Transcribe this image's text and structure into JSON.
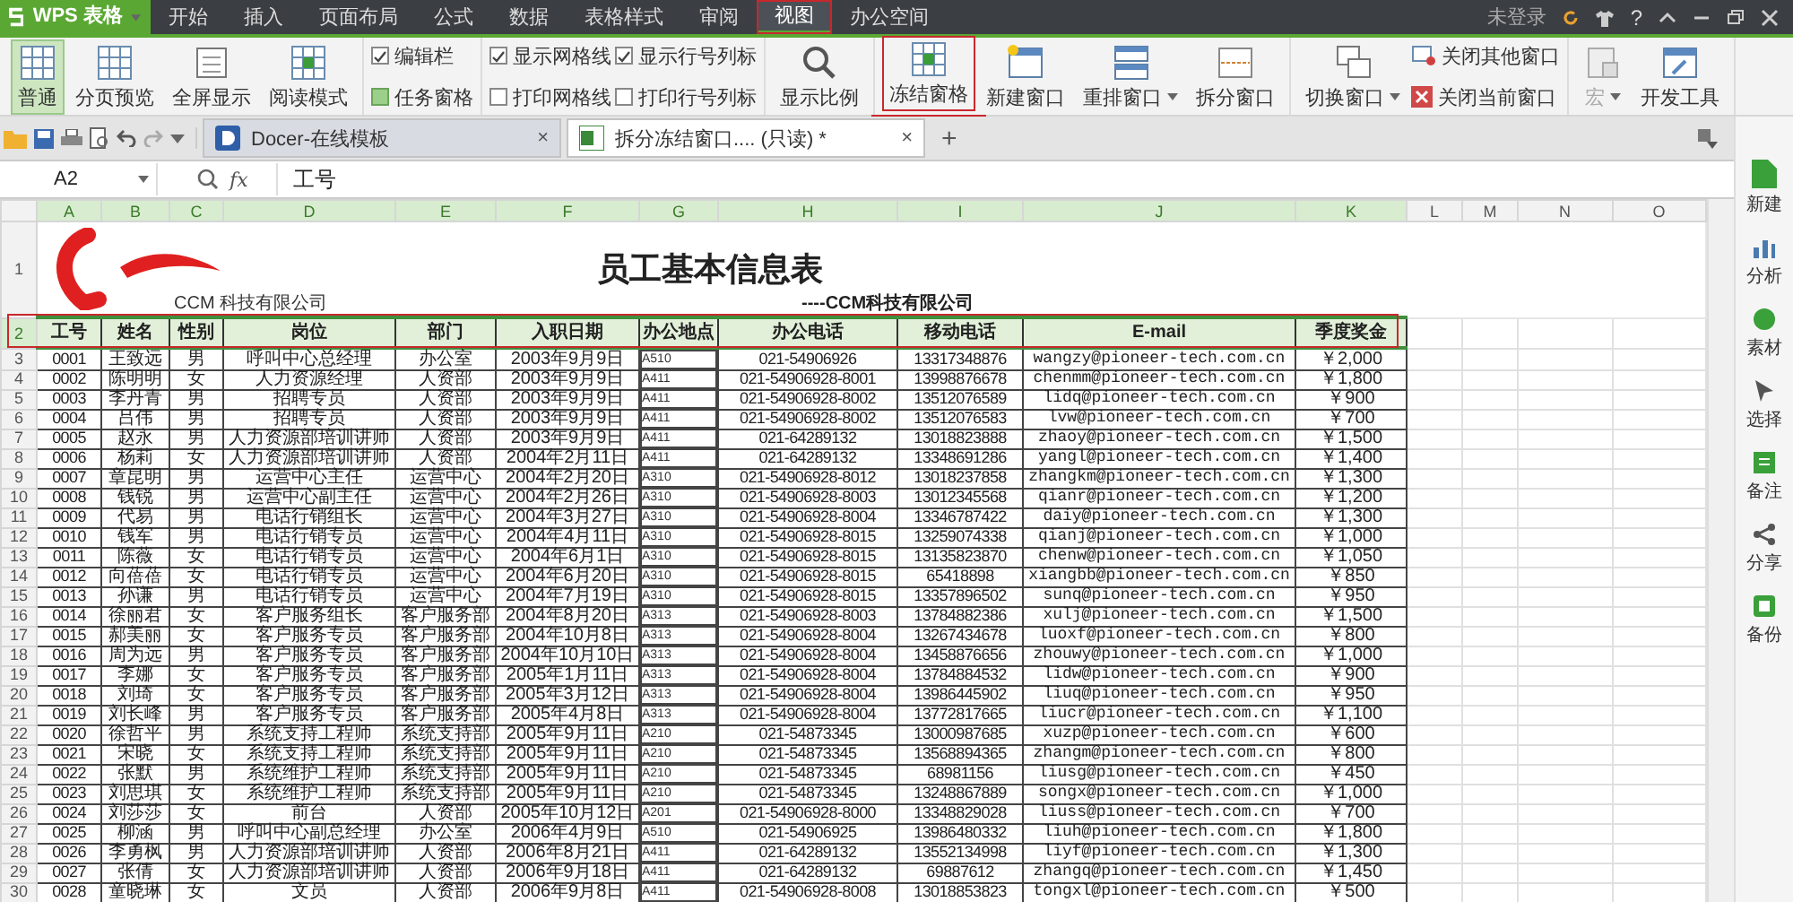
{
  "app": {
    "name": "WPS 表格"
  },
  "menu_tabs": [
    {
      "label": "开始",
      "selected": false,
      "annotated": false
    },
    {
      "label": "插入",
      "selected": false,
      "annotated": false
    },
    {
      "label": "页面布局",
      "selected": false,
      "annotated": false
    },
    {
      "label": "公式",
      "selected": false,
      "annotated": false
    },
    {
      "label": "数据",
      "selected": false,
      "annotated": false
    },
    {
      "label": "表格样式",
      "selected": false,
      "annotated": false
    },
    {
      "label": "审阅",
      "selected": false,
      "annotated": false
    },
    {
      "label": "视图",
      "selected": true,
      "annotated": true
    },
    {
      "label": "办公空间",
      "selected": false,
      "annotated": false
    }
  ],
  "account": {
    "status": "未登录",
    "help": "?"
  },
  "ribbon": {
    "groups": [
      {
        "items": [
          {
            "kind": "large",
            "label": "普通",
            "selected": true
          },
          {
            "kind": "large",
            "label": "分页预览",
            "selected": false
          },
          {
            "kind": "large",
            "label": "全屏显示",
            "selected": false
          },
          {
            "kind": "large",
            "label": "阅读模式",
            "selected": false
          }
        ]
      },
      {
        "items": [
          {
            "kind": "check",
            "label": "编辑栏",
            "checked": true
          },
          {
            "kind": "toggle",
            "label": "任务窗格",
            "checked": true
          }
        ]
      },
      {
        "items": [
          {
            "kind": "check",
            "label": "显示网格线",
            "checked": true
          },
          {
            "kind": "check",
            "label": "打印网格线",
            "checked": false
          },
          {
            "kind": "check",
            "label": "显示行号列标",
            "checked": true
          },
          {
            "kind": "check",
            "label": "打印行号列标",
            "checked": false
          }
        ]
      },
      {
        "items": [
          {
            "kind": "large",
            "label": "显示比例",
            "selected": false
          }
        ]
      },
      {
        "items": [
          {
            "kind": "large",
            "label": "冻结窗格",
            "selected": false,
            "annotated": true
          },
          {
            "kind": "large",
            "label": "新建窗口",
            "selected": false
          },
          {
            "kind": "large",
            "label": "重排窗口",
            "selected": false,
            "dropdown": true
          },
          {
            "kind": "large",
            "label": "拆分窗口",
            "selected": false
          }
        ]
      },
      {
        "items": [
          {
            "kind": "large",
            "label": "切换窗口",
            "selected": false,
            "dropdown": true
          },
          {
            "kind": "small",
            "label": "关闭其他窗口"
          },
          {
            "kind": "small",
            "label": "关闭当前窗口"
          }
        ]
      },
      {
        "items": [
          {
            "kind": "large",
            "label": "宏",
            "selected": false,
            "dropdown": true,
            "disabled": true
          },
          {
            "kind": "large",
            "label": "开发工具",
            "selected": false
          }
        ]
      }
    ]
  },
  "doc_tabs": [
    {
      "label": "Docer-在线模板",
      "selected": false,
      "close": "×"
    },
    {
      "label": "拆分冻结窗口.... (只读) *",
      "selected": true,
      "close": "×"
    }
  ],
  "new_tab": "+",
  "formula_bar": {
    "cell": "A2",
    "fx_label": "fx",
    "value": "工号"
  },
  "sheet": {
    "columns": [
      {
        "label": "A",
        "selected": true
      },
      {
        "label": "B",
        "selected": true
      },
      {
        "label": "C",
        "selected": true
      },
      {
        "label": "D",
        "selected": true
      },
      {
        "label": "E",
        "selected": true
      },
      {
        "label": "F",
        "selected": true
      },
      {
        "label": "G",
        "selected": true
      },
      {
        "label": "H",
        "selected": true
      },
      {
        "label": "I",
        "selected": true
      },
      {
        "label": "J",
        "selected": true
      },
      {
        "label": "K",
        "selected": true
      },
      {
        "label": "L",
        "selected": false
      },
      {
        "label": "M",
        "selected": false
      },
      {
        "label": "N",
        "selected": false
      },
      {
        "label": "O",
        "selected": false
      }
    ],
    "title_row": {
      "number": "1",
      "logo_text": "CCM 科技有限公司",
      "title": "员工基本信息表",
      "subtitle": "----CCM科技有限公司"
    },
    "header": {
      "number": "2",
      "selected": true,
      "annotated": true,
      "cells": [
        "工号",
        "姓名",
        "性别",
        "岗位",
        "部门",
        "入职日期",
        "办公地点",
        "办公电话",
        "移动电话",
        "E-mail",
        "季度奖金"
      ]
    },
    "rows": [
      {
        "number": "3",
        "selected": false,
        "cells": [
          "0001",
          "王致远",
          "男",
          "呼叫中心总经理",
          "办公室",
          "2003年9月9日",
          "A510",
          "021-54906926",
          "13317348876",
          "wangzy@pioneer-tech.com.cn",
          "￥2,000"
        ]
      },
      {
        "number": "4",
        "selected": false,
        "cells": [
          "0002",
          "陈明明",
          "女",
          "人力资源经理",
          "人资部",
          "2003年9月9日",
          "A411",
          "021-54906928-8001",
          "13998876678",
          "chenmm@pioneer-tech.com.cn",
          "￥1,800"
        ]
      },
      {
        "number": "5",
        "selected": false,
        "cells": [
          "0003",
          "李丹青",
          "男",
          "招聘专员",
          "人资部",
          "2003年9月9日",
          "A411",
          "021-54906928-8002",
          "13512076589",
          "lidq@pioneer-tech.com.cn",
          "￥900"
        ]
      },
      {
        "number": "6",
        "selected": false,
        "cells": [
          "0004",
          "吕伟",
          "男",
          "招聘专员",
          "人资部",
          "2003年9月9日",
          "A411",
          "021-54906928-8002",
          "13512076583",
          "lvw@pioneer-tech.com.cn",
          "￥700"
        ]
      },
      {
        "number": "7",
        "selected": false,
        "cells": [
          "0005",
          "赵永",
          "男",
          "人力资源部培训讲师",
          "人资部",
          "2003年9月9日",
          "A411",
          "021-64289132",
          "13018823888",
          "zhaoy@pioneer-tech.com.cn",
          "￥1,500"
        ]
      },
      {
        "number": "8",
        "selected": false,
        "cells": [
          "0006",
          "杨莉",
          "女",
          "人力资源部培训讲师",
          "人资部",
          "2004年2月11日",
          "A411",
          "021-64289132",
          "13348691286",
          "yangl@pioneer-tech.com.cn",
          "￥1,400"
        ]
      },
      {
        "number": "9",
        "selected": false,
        "cells": [
          "0007",
          "章昆明",
          "男",
          "运营中心主任",
          "运营中心",
          "2004年2月20日",
          "A310",
          "021-54906928-8012",
          "13018237858",
          "zhangkm@pioneer-tech.com.cn",
          "￥1,300"
        ]
      },
      {
        "number": "10",
        "selected": false,
        "cells": [
          "0008",
          "钱锐",
          "男",
          "运营中心副主任",
          "运营中心",
          "2004年2月26日",
          "A310",
          "021-54906928-8003",
          "13012345568",
          "qianr@pioneer-tech.com.cn",
          "￥1,200"
        ]
      },
      {
        "number": "11",
        "selected": false,
        "cells": [
          "0009",
          "代易",
          "男",
          "电话行销组长",
          "运营中心",
          "2004年3月27日",
          "A310",
          "021-54906928-8004",
          "13346787422",
          "daiy@pioneer-tech.com.cn",
          "￥1,300"
        ]
      },
      {
        "number": "12",
        "selected": false,
        "cells": [
          "0010",
          "钱军",
          "男",
          "电话行销专员",
          "运营中心",
          "2004年4月11日",
          "A310",
          "021-54906928-8015",
          "13259074338",
          "qianj@pioneer-tech.com.cn",
          "￥1,000"
        ]
      },
      {
        "number": "13",
        "selected": false,
        "cells": [
          "0011",
          "陈薇",
          "女",
          "电话行销专员",
          "运营中心",
          "2004年6月1日",
          "A310",
          "021-54906928-8015",
          "13135823870",
          "chenw@pioneer-tech.com.cn",
          "￥1,050"
        ]
      },
      {
        "number": "14",
        "selected": false,
        "cells": [
          "0012",
          "向蓓蓓",
          "女",
          "电话行销专员",
          "运营中心",
          "2004年6月20日",
          "A310",
          "021-54906928-8015",
          "65418898",
          "xiangbb@pioneer-tech.com.cn",
          "￥850"
        ]
      },
      {
        "number": "15",
        "selected": false,
        "cells": [
          "0013",
          "孙谦",
          "男",
          "电话行销专员",
          "运营中心",
          "2004年7月19日",
          "A310",
          "021-54906928-8015",
          "13357896502",
          "sunq@pioneer-tech.com.cn",
          "￥950"
        ]
      },
      {
        "number": "16",
        "selected": false,
        "cells": [
          "0014",
          "徐丽君",
          "女",
          "客户服务组长",
          "客户服务部",
          "2004年8月20日",
          "A313",
          "021-54906928-8003",
          "13784882386",
          "xulj@pioneer-tech.com.cn",
          "￥1,500"
        ]
      },
      {
        "number": "17",
        "selected": false,
        "cells": [
          "0015",
          "郝美丽",
          "女",
          "客户服务专员",
          "客户服务部",
          "2004年10月8日",
          "A313",
          "021-54906928-8004",
          "13267434678",
          "luoxf@pioneer-tech.com.cn",
          "￥800"
        ]
      },
      {
        "number": "18",
        "selected": false,
        "cells": [
          "0016",
          "周为远",
          "男",
          "客户服务专员",
          "客户服务部",
          "2004年10月10日",
          "A313",
          "021-54906928-8004",
          "13458876656",
          "zhouwy@pioneer-tech.com.cn",
          "￥1,000"
        ]
      },
      {
        "number": "19",
        "selected": false,
        "cells": [
          "0017",
          "李娜",
          "女",
          "客户服务专员",
          "客户服务部",
          "2005年1月11日",
          "A313",
          "021-54906928-8004",
          "13784884532",
          "lidw@pioneer-tech.com.cn",
          "￥900"
        ]
      },
      {
        "number": "20",
        "selected": false,
        "cells": [
          "0018",
          "刘琦",
          "女",
          "客户服务专员",
          "客户服务部",
          "2005年3月12日",
          "A313",
          "021-54906928-8004",
          "13986445902",
          "liuq@pioneer-tech.com.cn",
          "￥950"
        ]
      },
      {
        "number": "21",
        "selected": false,
        "cells": [
          "0019",
          "刘长峰",
          "男",
          "客户服务专员",
          "客户服务部",
          "2005年4月8日",
          "A313",
          "021-54906928-8004",
          "13772817665",
          "liucr@pioneer-tech.com.cn",
          "￥1,100"
        ]
      },
      {
        "number": "22",
        "selected": false,
        "cells": [
          "0020",
          "徐哲平",
          "男",
          "系统支持工程师",
          "系统支持部",
          "2005年9月11日",
          "A210",
          "021-54873345",
          "13000987685",
          "xuzp@pioneer-tech.com.cn",
          "￥600"
        ]
      },
      {
        "number": "23",
        "selected": false,
        "cells": [
          "0021",
          "宋晓",
          "女",
          "系统支持工程师",
          "系统支持部",
          "2005年9月11日",
          "A210",
          "021-54873345",
          "13568894365",
          "zhangm@pioneer-tech.com.cn",
          "￥800"
        ]
      },
      {
        "number": "24",
        "selected": false,
        "cells": [
          "0022",
          "张默",
          "男",
          "系统维护工程师",
          "系统支持部",
          "2005年9月11日",
          "A210",
          "021-54873345",
          "68981156",
          "liusg@pioneer-tech.com.cn",
          "￥450"
        ]
      },
      {
        "number": "25",
        "selected": false,
        "cells": [
          "0023",
          "刘思琪",
          "女",
          "系统维护工程师",
          "系统支持部",
          "2005年9月11日",
          "A210",
          "021-54873345",
          "13248867889",
          "songx@pioneer-tech.com.cn",
          "￥1,000"
        ]
      },
      {
        "number": "26",
        "selected": false,
        "cells": [
          "0024",
          "刘莎莎",
          "女",
          "前台",
          "人资部",
          "2005年10月12日",
          "A201",
          "021-54906928-8000",
          "13348829028",
          "liuss@pioneer-tech.com.cn",
          "￥700"
        ]
      },
      {
        "number": "27",
        "selected": false,
        "cells": [
          "0025",
          "柳涵",
          "男",
          "呼叫中心副总经理",
          "办公室",
          "2006年4月9日",
          "A510",
          "021-54906925",
          "13986480332",
          "liuh@pioneer-tech.com.cn",
          "￥1,800"
        ]
      },
      {
        "number": "28",
        "selected": false,
        "cells": [
          "0026",
          "李勇枫",
          "男",
          "人力资源部培训讲师",
          "人资部",
          "2006年8月21日",
          "A411",
          "021-64289132",
          "13552134998",
          "liyf@pioneer-tech.com.cn",
          "￥1,300"
        ]
      },
      {
        "number": "29",
        "selected": false,
        "cells": [
          "0027",
          "张倩",
          "女",
          "人力资源部培训讲师",
          "人资部",
          "2006年9月18日",
          "A411",
          "021-64289132",
          "69887612",
          "zhangq@pioneer-tech.com.cn",
          "￥1,450"
        ]
      },
      {
        "number": "30",
        "selected": false,
        "cells": [
          "0028",
          "童晓琳",
          "女",
          "文员",
          "人资部",
          "2006年9月8日",
          "A411",
          "021-54906928-8008",
          "13018853823",
          "tongxl@pioneer-tech.com.cn",
          "￥500"
        ]
      }
    ]
  },
  "side_panel": [
    {
      "label": "新建"
    },
    {
      "label": "分析"
    },
    {
      "label": "素材"
    },
    {
      "label": "选择"
    },
    {
      "label": "备注"
    },
    {
      "label": "分享"
    },
    {
      "label": "备份"
    }
  ]
}
